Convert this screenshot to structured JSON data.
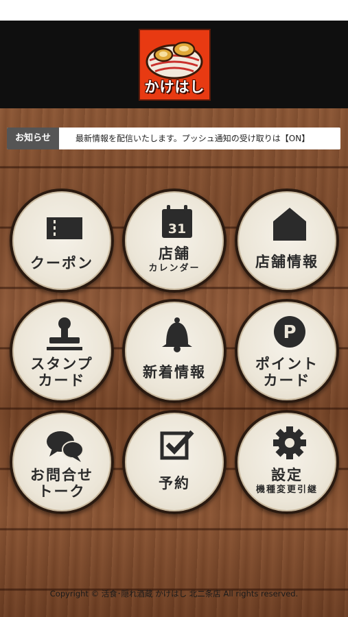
{
  "header": {
    "logo_text": "かけはし"
  },
  "news": {
    "label": "お知らせ",
    "text": "最新情報を配信いたします。プッシュ通知の受け取りは【ON】"
  },
  "menu": [
    {
      "lines": [
        "クーポン"
      ],
      "icon": "ticket-icon"
    },
    {
      "lines": [
        "店舗",
        "カレンダー"
      ],
      "icon": "calendar-icon",
      "calendar_day": "31"
    },
    {
      "lines": [
        "店舗情報"
      ],
      "icon": "house-icon"
    },
    {
      "lines": [
        "スタンプ",
        "カード"
      ],
      "icon": "stamp-icon"
    },
    {
      "lines": [
        "新着情報"
      ],
      "icon": "bell-icon"
    },
    {
      "lines": [
        "ポイント",
        "カード"
      ],
      "icon": "coin-icon",
      "coin_letter": "P"
    },
    {
      "lines": [
        "お問合せ",
        "トーク"
      ],
      "icon": "chat-icon"
    },
    {
      "lines": [
        "予約"
      ],
      "icon": "checkbox-icon"
    },
    {
      "lines": [
        "設定",
        "機種変更引継"
      ],
      "icon": "gear-icon"
    }
  ],
  "footer": {
    "copyright": "Copyright © 活食･隠れ酒蔵 かけはし 北二条店 All rights reserved."
  },
  "colors": {
    "header_bg": "#0f0f0f",
    "logo_bg": "#e83a12",
    "news_label_bg": "#555555",
    "button_face": "#ece6d8",
    "icon_color": "#2b2b2b"
  }
}
